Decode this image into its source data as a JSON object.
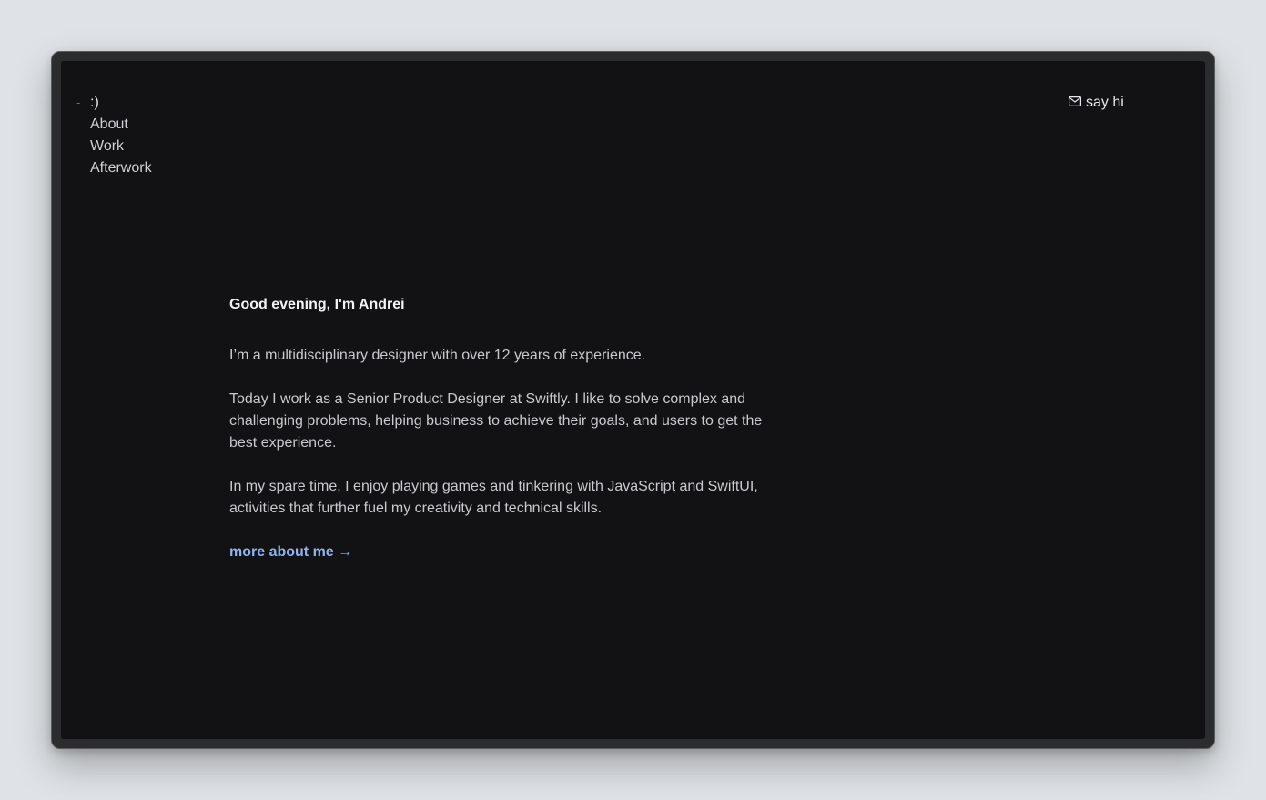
{
  "nav": {
    "home_dash": "-",
    "home_label": ":)",
    "items": [
      {
        "label": "About"
      },
      {
        "label": "Work"
      },
      {
        "label": "Afterwork"
      }
    ]
  },
  "contact": {
    "icon": "mail-icon",
    "label": "say hi"
  },
  "intro": {
    "greeting": "Good evening, I'm Andrei",
    "paragraphs": [
      "I’m a multidisciplinary designer with over 12 years of experience.",
      "Today I work as a Senior Product Designer at Swiftly. I like to solve complex and challenging problems, helping business to achieve their goals, and users to get the best experience.",
      "In my spare time, I enjoy playing games and tinkering with JavaScript and SwiftUI, activities that further fuel my creativity and technical skills."
    ],
    "more_link": "more about me →"
  },
  "colors": {
    "background": "#121214",
    "accent_link": "#8fb4f4",
    "outer": "#dfe3e7"
  }
}
